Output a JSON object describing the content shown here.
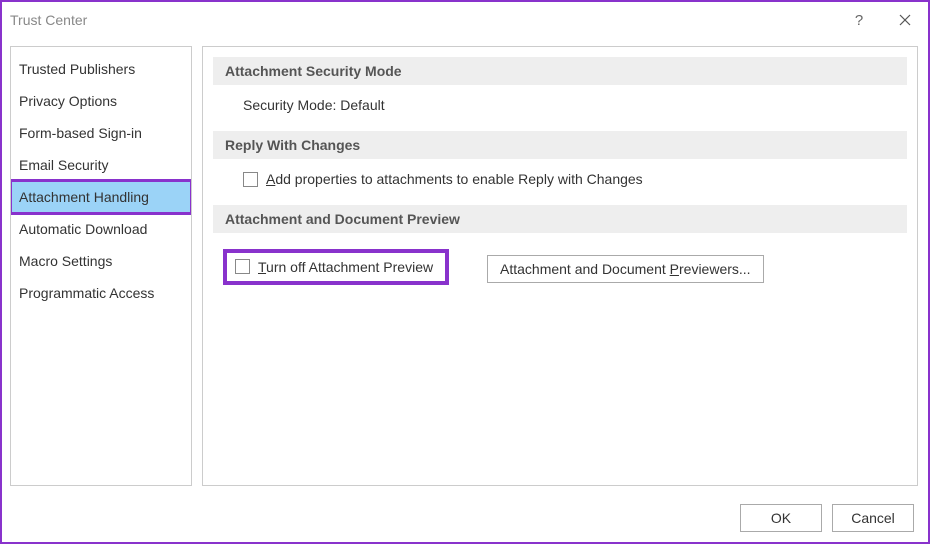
{
  "window": {
    "title": "Trust Center"
  },
  "sidebar": {
    "items": [
      {
        "label": "Trusted Publishers"
      },
      {
        "label": "Privacy Options"
      },
      {
        "label": "Form-based Sign-in"
      },
      {
        "label": "Email Security"
      },
      {
        "label": "Attachment Handling",
        "selected": true
      },
      {
        "label": "Automatic Download"
      },
      {
        "label": "Macro Settings"
      },
      {
        "label": "Programmatic Access"
      }
    ]
  },
  "content": {
    "section1": {
      "header": "Attachment Security Mode",
      "body_prefix": "Security Mode: ",
      "body_value": "Default"
    },
    "section2": {
      "header": "Reply With Changes",
      "checkbox_prefix": "A",
      "checkbox_rest": "dd properties to attachments to enable Reply with Changes"
    },
    "section3": {
      "header": "Attachment and Document Preview",
      "checkbox_prefix": "T",
      "checkbox_rest": "urn off Attachment Preview",
      "button_prefix": "Attachment and Document ",
      "button_u": "P",
      "button_rest": "reviewers..."
    }
  },
  "footer": {
    "ok": "OK",
    "cancel": "Cancel"
  }
}
